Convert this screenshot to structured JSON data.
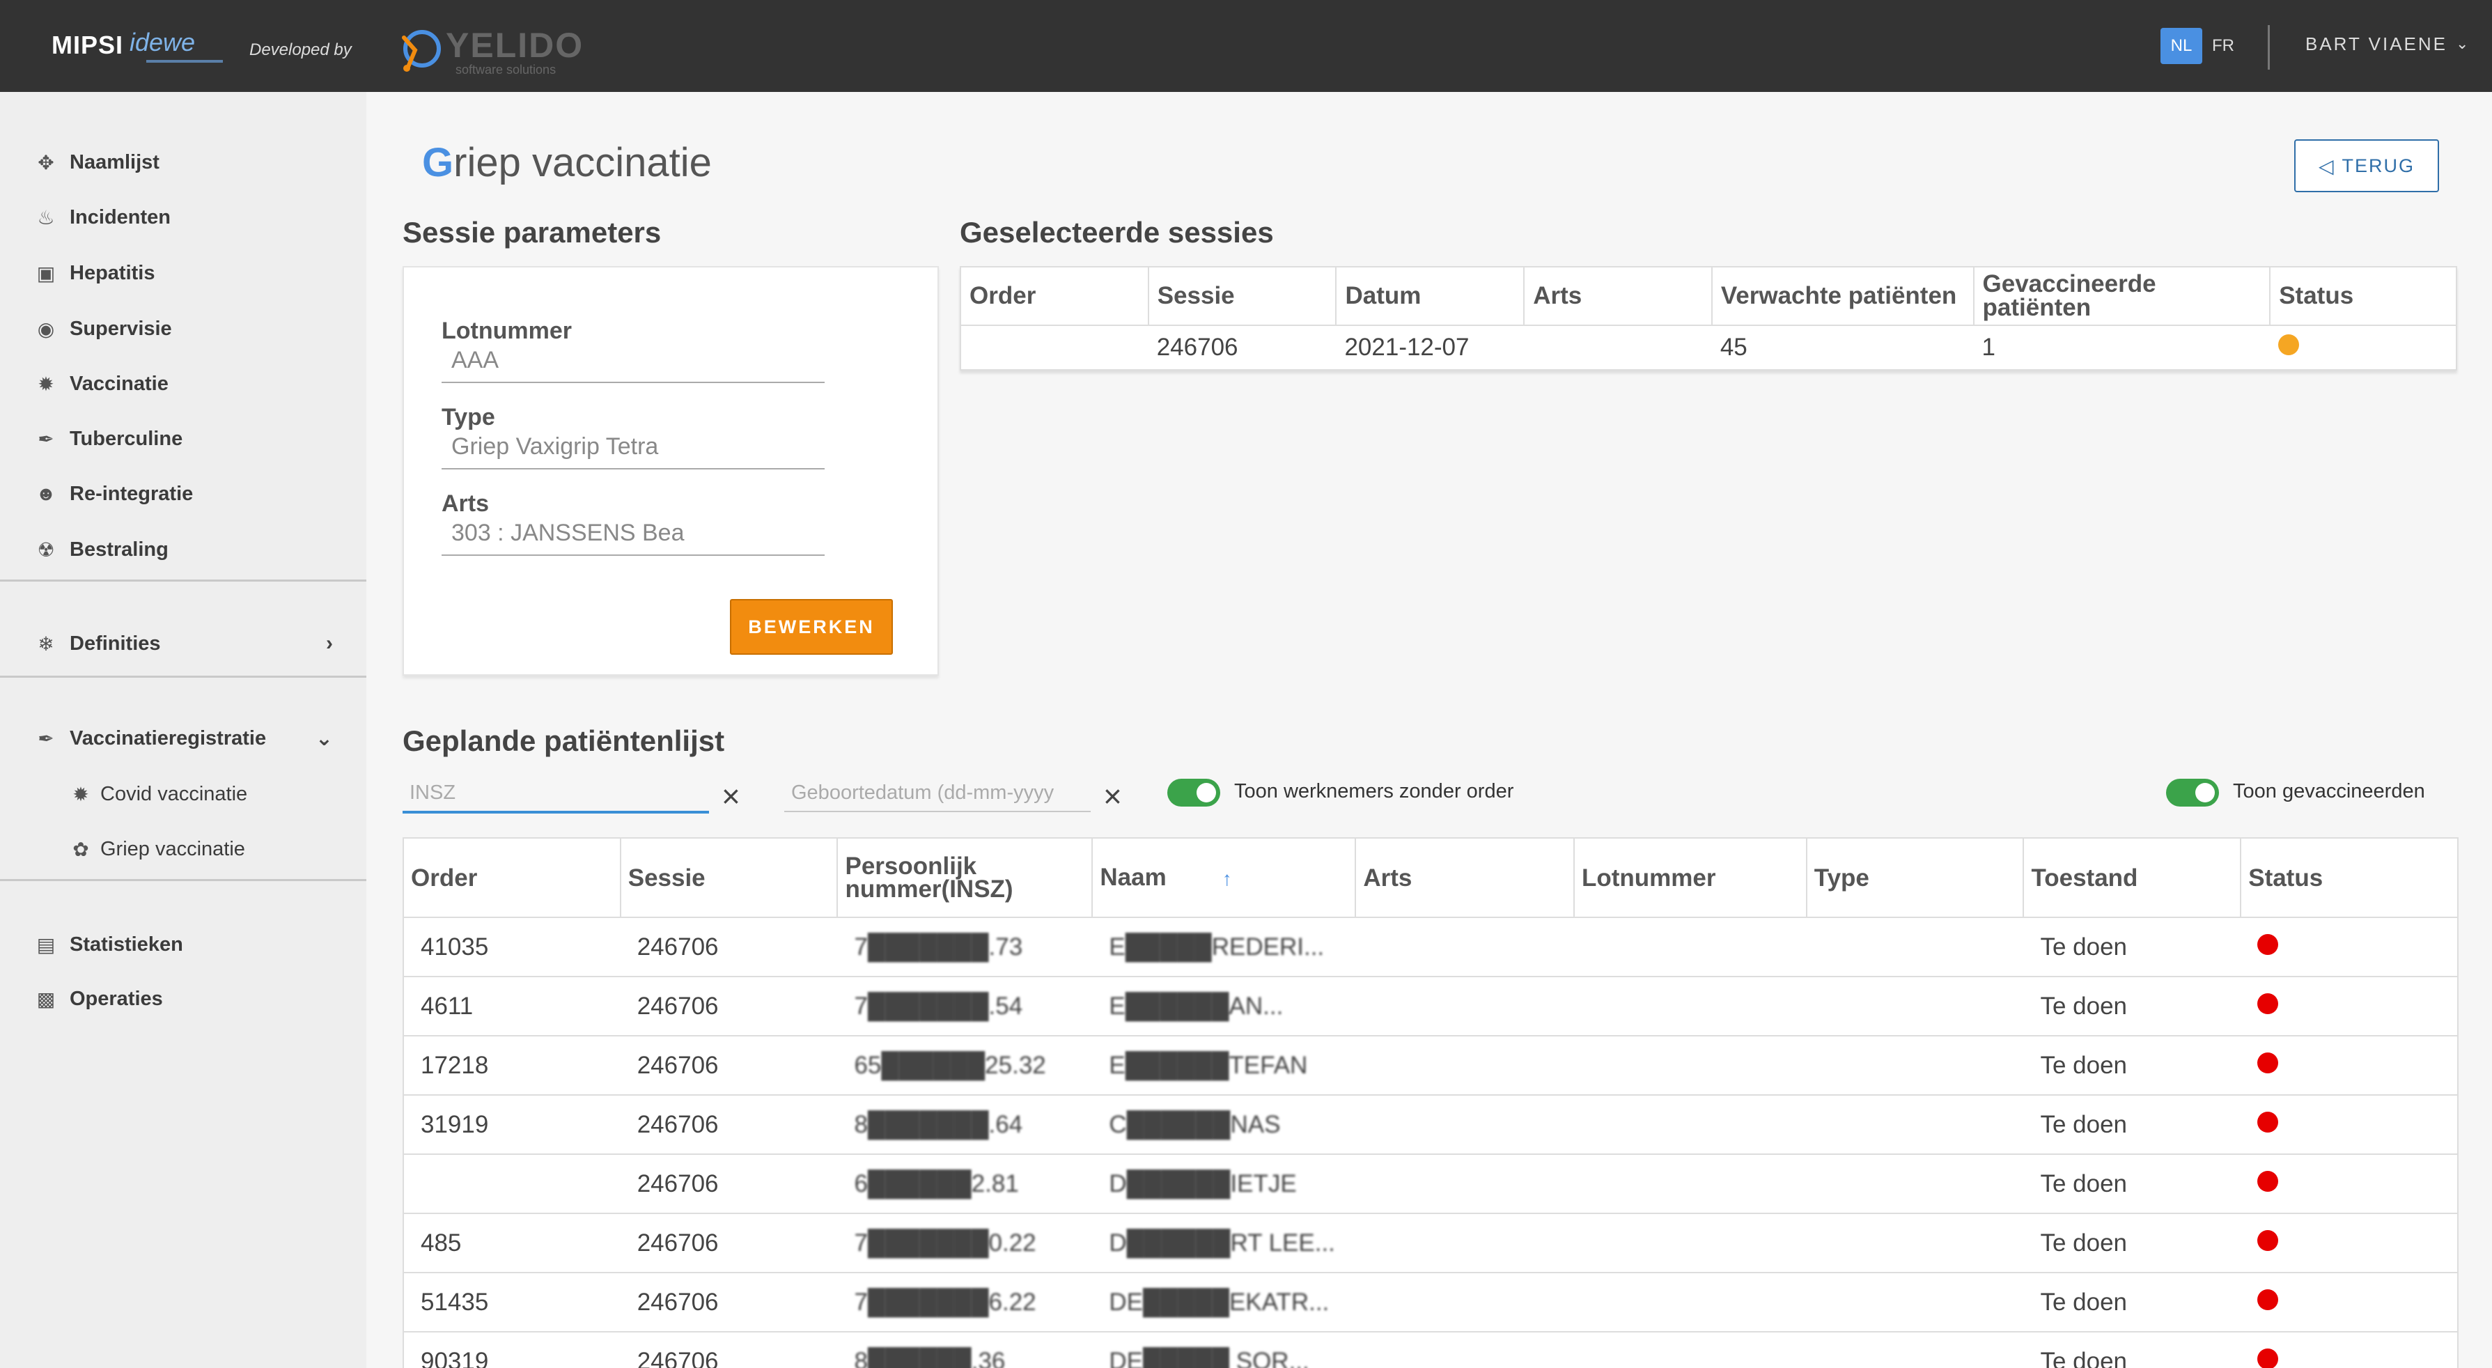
{
  "header": {
    "logo_mipsi": "MIPSI",
    "logo_idewe": "idewe",
    "developed_by": "Developed by",
    "yelido": "YELIDO",
    "yelido_sub": "software solutions",
    "lang_nl": "NL",
    "lang_fr": "FR",
    "user": "BART VIAENE"
  },
  "sidebar": {
    "items": [
      {
        "label": "Naamlijst",
        "icon": "crosshair-icon"
      },
      {
        "label": "Incidenten",
        "icon": "flame-icon"
      },
      {
        "label": "Hepatitis",
        "icon": "camera-icon"
      },
      {
        "label": "Supervisie",
        "icon": "eye-icon"
      },
      {
        "label": "Vaccinatie",
        "icon": "virus-icon"
      },
      {
        "label": "Tuberculine",
        "icon": "syringe-icon"
      },
      {
        "label": "Re-integratie",
        "icon": "person-icon"
      },
      {
        "label": "Bestraling",
        "icon": "radiation-icon"
      }
    ],
    "definities": "Definities",
    "vaccinatieregistratie": "Vaccinatieregistratie",
    "sub_items": [
      "Covid vaccinatie",
      "Griep vaccinatie"
    ],
    "statistieken": "Statistieken",
    "operaties": "Operaties"
  },
  "page": {
    "title_first": "G",
    "title_rest": "riep vaccinatie",
    "terug": "TERUG"
  },
  "params": {
    "title": "Sessie parameters",
    "lot_label": "Lotnummer",
    "lot_value": "AAA",
    "type_label": "Type",
    "type_value": "Griep Vaxigrip Tetra",
    "arts_label": "Arts",
    "arts_value": "303 : JANSSENS Bea",
    "edit": "BEWERKEN"
  },
  "sessions": {
    "title": "Geselecteerde sessies",
    "columns": [
      "Order",
      "Sessie",
      "Datum",
      "Arts",
      "Verwachte patiënten",
      "Gevaccineerde patiënten",
      "Status"
    ],
    "rows": [
      {
        "order": "",
        "sessie": "246706",
        "datum": "2021-12-07",
        "arts": "",
        "verwacht": "45",
        "gevaccineerd": "1",
        "status_color": "#f5a623"
      }
    ]
  },
  "patients": {
    "title": "Geplande patiëntenlijst",
    "insz_placeholder": "INSZ",
    "dob_placeholder": "Geboortedatum (dd-mm-yyyy",
    "toggle1": "Toon werknemers zonder order",
    "toggle2": "Toon gevaccineerden",
    "columns": [
      "Order",
      "Sessie",
      "Persoonlijk nummer(INSZ)",
      "Naam",
      "Arts",
      "Lotnummer",
      "Type",
      "Toestand",
      "Status"
    ],
    "rows": [
      {
        "order": "41035",
        "sessie": "246706",
        "insz": "7███████.73",
        "naam": "E█████REDERI...",
        "toestand": "Te doen",
        "status_color": "#e60000"
      },
      {
        "order": "4611",
        "sessie": "246706",
        "insz": "7███████.54",
        "naam": "E██████AN...",
        "toestand": "Te doen",
        "status_color": "#e60000"
      },
      {
        "order": "17218",
        "sessie": "246706",
        "insz": "65██████25.32",
        "naam": "E██████TEFAN",
        "toestand": "Te doen",
        "status_color": "#e60000"
      },
      {
        "order": "31919",
        "sessie": "246706",
        "insz": "8███████.64",
        "naam": "C██████NAS",
        "toestand": "Te doen",
        "status_color": "#e60000"
      },
      {
        "order": "",
        "sessie": "246706",
        "insz": "6██████2.81",
        "naam": "D██████IETJE",
        "toestand": "Te doen",
        "status_color": "#e60000"
      },
      {
        "order": "485",
        "sessie": "246706",
        "insz": "7███████0.22",
        "naam": "D██████RT LEE...",
        "toestand": "Te doen",
        "status_color": "#e60000"
      },
      {
        "order": "51435",
        "sessie": "246706",
        "insz": "7███████6.22",
        "naam": "DE█████EKATR...",
        "toestand": "Te doen",
        "status_color": "#e60000"
      },
      {
        "order": "90319",
        "sessie": "246706",
        "insz": "8██████.36",
        "naam": "DE█████ SOR...",
        "toestand": "Te doen",
        "status_color": "#e60000"
      }
    ]
  }
}
